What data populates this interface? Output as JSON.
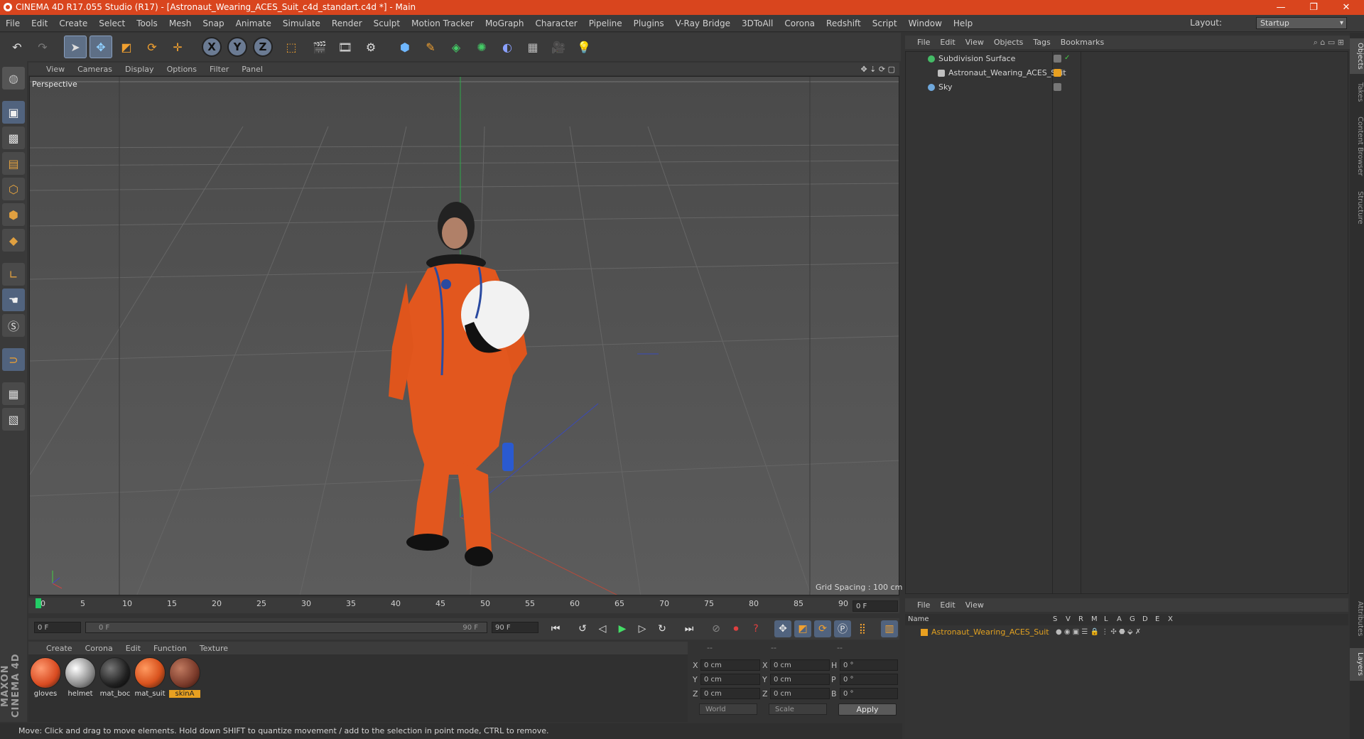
{
  "window": {
    "title": "CINEMA 4D R17.055 Studio (R17) - [Astronaut_Wearing_ACES_Suit_c4d_standart.c4d *] - Main",
    "minimize_icon": "minimize-icon",
    "maximize_icon": "restore-icon",
    "close_icon": "close-icon"
  },
  "menu": [
    "File",
    "Edit",
    "Create",
    "Select",
    "Tools",
    "Mesh",
    "Snap",
    "Animate",
    "Simulate",
    "Render",
    "Sculpt",
    "Motion Tracker",
    "MoGraph",
    "Character",
    "Pipeline",
    "Plugins",
    "V-Ray Bridge",
    "3DToAll",
    "Corona",
    "Redshift",
    "Script",
    "Window",
    "Help"
  ],
  "layout": {
    "label": "Layout:",
    "value": "Startup"
  },
  "viewport": {
    "menu": [
      "View",
      "Cameras",
      "Display",
      "Options",
      "Filter",
      "Panel"
    ],
    "camera_label": "Perspective",
    "grid_spacing": "Grid Spacing : 100 cm"
  },
  "object_manager": {
    "menu": [
      "File",
      "Edit",
      "View",
      "Objects",
      "Tags",
      "Bookmarks"
    ],
    "objects": [
      {
        "name": "Subdivision Surface",
        "color": "#44bb66"
      },
      {
        "name": "Astronaut_Wearing_ACES_Suit",
        "color": "#c0c0c0"
      },
      {
        "name": "Sky",
        "color": "#6fa8dc"
      }
    ]
  },
  "side_tabs": [
    "Objects",
    "Takes",
    "Content Browser",
    "Structure",
    "Attributes",
    "Layers"
  ],
  "layer_manager": {
    "menu": [
      "File",
      "Edit",
      "View"
    ],
    "columns": [
      "Name",
      "S",
      "V",
      "R",
      "M",
      "L",
      "A",
      "G",
      "D",
      "E",
      "X"
    ],
    "layers": [
      {
        "name": "Astronaut_Wearing_ACES_Suit",
        "color": "#e8a020"
      }
    ]
  },
  "timeline": {
    "ticks": [
      "0",
      "5",
      "10",
      "15",
      "20",
      "25",
      "30",
      "35",
      "40",
      "45",
      "50",
      "55",
      "60",
      "65",
      "70",
      "75",
      "80",
      "85",
      "90"
    ],
    "current_frame": "0 F",
    "start_field": "0 F",
    "range_start": "0 F",
    "range_end": "90 F",
    "end_field": "90 F"
  },
  "material_manager": {
    "menu": [
      "Create",
      "Corona",
      "Edit",
      "Function",
      "Texture"
    ],
    "materials": [
      {
        "name": "gloves",
        "color": "#d84a20",
        "selected": false
      },
      {
        "name": "helmet",
        "color": "#8a8a8a",
        "selected": false
      },
      {
        "name": "mat_boc",
        "color": "#202020",
        "selected": false
      },
      {
        "name": "mat_suit",
        "color": "#d9531e",
        "selected": false
      },
      {
        "name": "skinA",
        "color": "#7a3a2a",
        "selected": true
      }
    ]
  },
  "coordinates": {
    "header": [
      "--",
      "--",
      "--"
    ],
    "rows": [
      {
        "a": "X",
        "v1": "0 cm",
        "b": "X",
        "v2": "0 cm",
        "c": "H",
        "v3": "0 °"
      },
      {
        "a": "Y",
        "v1": "0 cm",
        "b": "Y",
        "v2": "0 cm",
        "c": "P",
        "v3": "0 °"
      },
      {
        "a": "Z",
        "v1": "0 cm",
        "b": "Z",
        "v2": "0 cm",
        "c": "B",
        "v3": "0 °"
      }
    ],
    "mode1": "World",
    "mode2": "Scale",
    "apply": "Apply"
  },
  "branding": "MAXON CINEMA 4D",
  "status": "Move: Click and drag to move elements. Hold down SHIFT to quantize movement / add to the selection in point mode, CTRL to remove."
}
